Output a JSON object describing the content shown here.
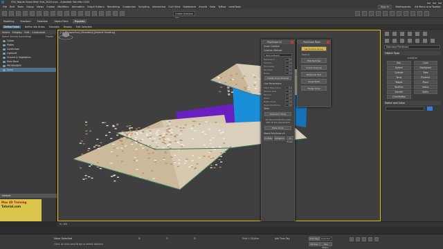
{
  "window": {
    "title": "026_Tegula Snow Mesh End_2020.max - Autodesk 3ds Max 2020"
  },
  "menu": {
    "items": [
      "File",
      "Edit",
      "Tools",
      "Group",
      "Views",
      "Create",
      "Modifiers",
      "Animation",
      "Graph Editors",
      "Rendering",
      "Customize",
      "Scripting",
      "Interactive",
      "Civil View",
      "Substance",
      "Arnold",
      "Help",
      "Tyflow",
      "ravelTools"
    ],
    "signin": "Sign In",
    "workspaces_label": "Workspaces:",
    "workspace": "Alt Menu and Toolbar"
  },
  "toolbar": {
    "selection_set": "Create Selection Set"
  },
  "ribbon": {
    "tabs": [
      "Modeling",
      "Freeform",
      "Selection",
      "Object Paint",
      "Populate"
    ],
    "active": "Populate",
    "subtabs": [
      "Define Flows",
      "Define Idle Areas",
      "Simulate",
      "Display",
      "Edit Selected"
    ]
  },
  "scene": {
    "tabs": [
      "Select",
      "Display",
      "Edit",
      "Customize"
    ],
    "header": "Name (Sorted Ascending)",
    "frozen_label": "Frozen",
    "items": [
      {
        "name": "Cubes",
        "selected": false
      },
      {
        "name": "Plates",
        "selected": false
      },
      {
        "name": "Landscape",
        "selected": false
      },
      {
        "name": "LightsuR",
        "selected": false
      },
      {
        "name": "Ground & Vegetation",
        "selected": false
      },
      {
        "name": "Main Base",
        "selected": false
      },
      {
        "name": "PRORENDER",
        "selected": false
      },
      {
        "name": "Snow",
        "selected": true
      }
    ],
    "default_layer": "Default"
  },
  "viewport": {
    "label": "[+] [Perspective] [Standard] [Default Shading]"
  },
  "command_panel": {
    "dropdown": "Standard Primitives",
    "object_type_title": "Object Type",
    "autogrid": "AutoGrid",
    "objects": [
      "Box",
      "Cone",
      "Sphere",
      "GeoSphere",
      "Cylinder",
      "Tube",
      "Torus",
      "Pyramid",
      "Teapot",
      "Plane",
      "TextPlus",
      "Hedra",
      "Spindle",
      "Stairs",
      "ChamferBox"
    ],
    "name_color_title": "Name and Color"
  },
  "polysnow": {
    "title": "PolySnow v3",
    "section_creation": "Snow Creation",
    "creation_method": "Creation Method",
    "method_value": "Particle Based",
    "params": [
      {
        "label": "Resolution",
        "value": "0.0"
      },
      {
        "label": "Smooth",
        "value": "0.0"
      },
      {
        "label": "Thickness",
        "value": "0.0"
      },
      {
        "label": "Particles",
        "value": "0.0"
      },
      {
        "label": "Noise",
        "value": "0.0"
      }
    ],
    "create_button": "Create Snow Preview",
    "section_live": "Live Parameters",
    "live_params": [
      {
        "label": "Mesh Resolution",
        "value": "0.0"
      },
      {
        "label": "Particle Size",
        "value": "0.0"
      },
      {
        "label": "Tension",
        "value": "0.0"
      },
      {
        "label": "Relax",
        "value": "0.0"
      },
      {
        "label": "Relax Value",
        "value": "0.0"
      },
      {
        "label": "Relax Iterations",
        "value": "0.0"
      }
    ],
    "section_tools": "Tools",
    "tools_button": "Distortion Tools",
    "note": "You should bake the snow after all the adjustments",
    "bake_button": "Bake Snow",
    "about_title": "About PolySnow v3",
    "about_buttons": [
      "YouTube",
      "Instagram",
      "3d Forum"
    ]
  },
  "tools_panel": {
    "title": "PolySnow Tools",
    "buttons": [
      "Set Surface Group",
      "Edit Particles",
      "Scene Cleanup",
      "PolySnow Tool",
      "Snow Paint",
      "Merge Snow"
    ],
    "highlighted": 0,
    "checkbox": "Show UI"
  },
  "timeline": {
    "frame": "0 / 100"
  },
  "status": {
    "line1": "None Selected",
    "line2": "Click or click-and-drag to select objects",
    "x_label": "X:",
    "y_label": "Y:",
    "z_label": "Z:",
    "grid": "Grid = 10,0cm",
    "add_time_tag": "Add Time Tag",
    "auto_key": "Auto Key",
    "selected": "Selected",
    "set_key": "Set Key",
    "key_filters": "Key Filters..."
  },
  "watermark": {
    "line1": "Max 3D Training",
    "line2": "Tutorial.com"
  }
}
